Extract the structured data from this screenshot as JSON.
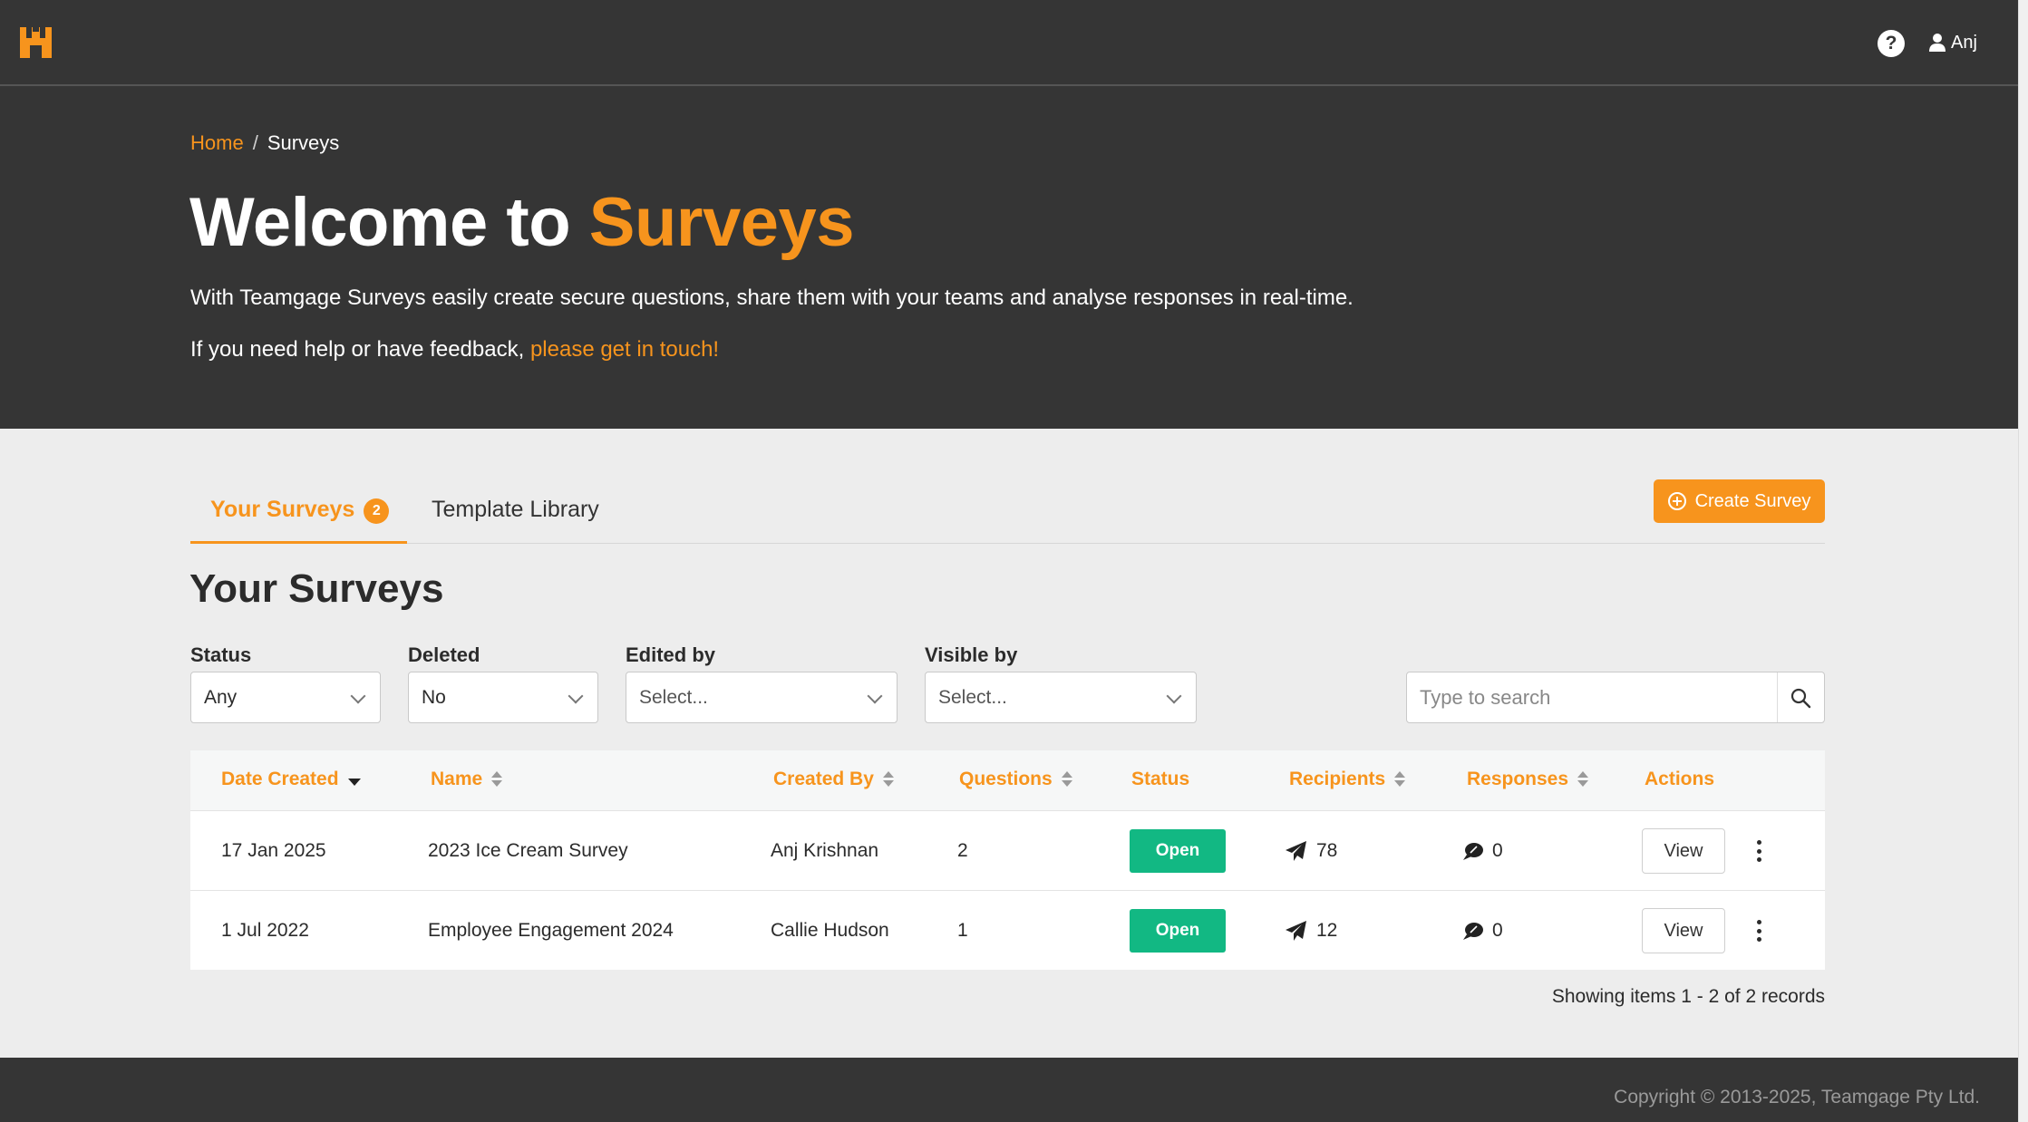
{
  "nav": {
    "help_label": "?",
    "user_name": "Anj"
  },
  "breadcrumb": {
    "home": "Home",
    "separator": "/",
    "current": "Surveys"
  },
  "hero": {
    "title_prefix": "Welcome to",
    "title_accent": "Surveys",
    "intro": "With Teamgage Surveys easily create secure questions, share them with your teams and analyse responses in real-time.",
    "help_prefix": "If you need help or have feedback,",
    "help_link": "please get in touch!"
  },
  "tabs": [
    {
      "label": "Your Surveys",
      "count": "2",
      "active": true
    },
    {
      "label": "Template Library",
      "active": false
    }
  ],
  "create_button": "Create Survey",
  "section_title": "Your Surveys",
  "filters": {
    "status": {
      "label": "Status",
      "value": "Any"
    },
    "deleted": {
      "label": "Deleted",
      "value": "No"
    },
    "edited_by": {
      "label": "Edited by",
      "value": "Select..."
    },
    "visible_by": {
      "label": "Visible by",
      "value": "Select..."
    },
    "search_placeholder": "Type to search"
  },
  "table": {
    "columns": [
      "Date Created",
      "Name",
      "Created By",
      "Questions",
      "Status",
      "Recipients",
      "Responses",
      "Actions"
    ],
    "rows": [
      {
        "date": "17 Jan 2025",
        "name": "2023 Ice Cream Survey",
        "created_by": "Anj Krishnan",
        "questions": "2",
        "status": "Open",
        "recipients": "78",
        "responses": "0",
        "action": "View"
      },
      {
        "date": "1 Jul 2022",
        "name": "Employee Engagement 2024",
        "created_by": "Callie Hudson",
        "questions": "1",
        "status": "Open",
        "recipients": "12",
        "responses": "0",
        "action": "View"
      }
    ]
  },
  "records_text": "Showing items 1 - 2 of 2 records",
  "footer": "Copyright © 2013-2025, Teamgage Pty Ltd.",
  "colors": {
    "accent": "#f7941d",
    "dark_bg": "#353535",
    "status_open": "#12b883",
    "page_bg": "#ededed"
  },
  "icons": [
    "logo-icon",
    "help-icon",
    "user-icon",
    "plus-circle-icon",
    "chevron-down-icon",
    "search-icon",
    "sort-icon",
    "sort-desc-icon",
    "paper-plane-icon",
    "comment-icon",
    "kebab-icon"
  ]
}
